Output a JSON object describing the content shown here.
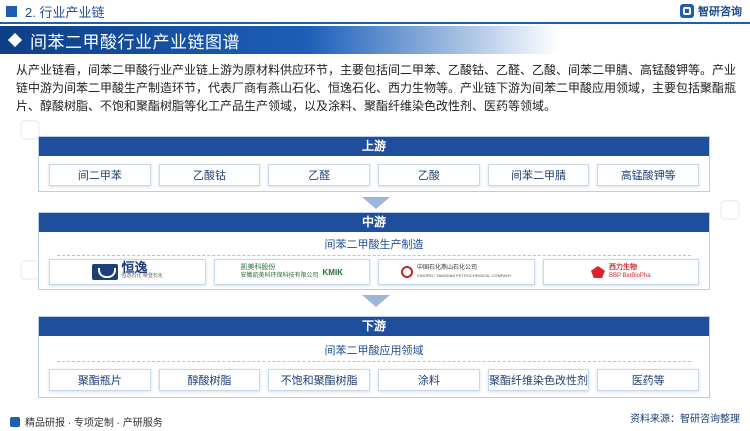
{
  "header": {
    "section": "2. 行业产业链",
    "brand": "智研咨询"
  },
  "banner": {
    "title": "间苯二甲酸行业产业链图谱"
  },
  "intro": {
    "text": "从产业链看，间苯二甲酸行业产业链上游为原材料供应环节，主要包括间二甲苯、乙酸钴、乙醛、乙酸、间苯二甲腈、高锰酸钾等。产业链中游为间苯二甲酸生产制造环节，代表厂商有燕山石化、恒逸石化、西力生物等。产业链下游为间苯二甲酸应用领域，主要包括聚酯瓶片、醇酸树脂、不饱和聚酯树脂等化工产品生产领域，以及涂料、聚酯纤维染色改性剂、医药等领域。"
  },
  "upstream": {
    "title": "上游",
    "items": [
      "间二甲苯",
      "乙酸钴",
      "乙醛",
      "乙酸",
      "间苯二甲腈",
      "高锰酸钾等"
    ]
  },
  "midstream": {
    "title": "中游",
    "subtitle": "间苯二甲酸生产制造",
    "companies": [
      {
        "name": "恒逸",
        "small": "恒逸石化 荣登石化",
        "icon": "hengyi-logo"
      },
      {
        "cn": "凯美科股份",
        "en": "KMIK",
        "full": "安徽凯美科环保科技有限公司",
        "icon": "kmik-logo"
      },
      {
        "cn": "中国石化燕山石化公司",
        "en": "SINOPEC YANSHAN PETROCHEMICAL COMPANY",
        "icon": "sinopec-logo"
      },
      {
        "cn": "西力生物",
        "en": "BBP BioBioPha",
        "icon": "biobiopha-logo"
      }
    ]
  },
  "downstream": {
    "title": "下游",
    "subtitle": "间苯二甲酸应用领域",
    "items": [
      "聚酯瓶片",
      "醇酸树脂",
      "不饱和聚酯树脂",
      "涂料",
      "聚酯纤维染色改性剂",
      "医药等"
    ]
  },
  "footer": {
    "left": "精品研报 · 专项定制 · 产研服务",
    "source": "资料来源：智研咨询整理"
  },
  "colors": {
    "primary": "#1f4f9c",
    "accent": "#1f5fb0",
    "border": "#c8d8ec"
  }
}
